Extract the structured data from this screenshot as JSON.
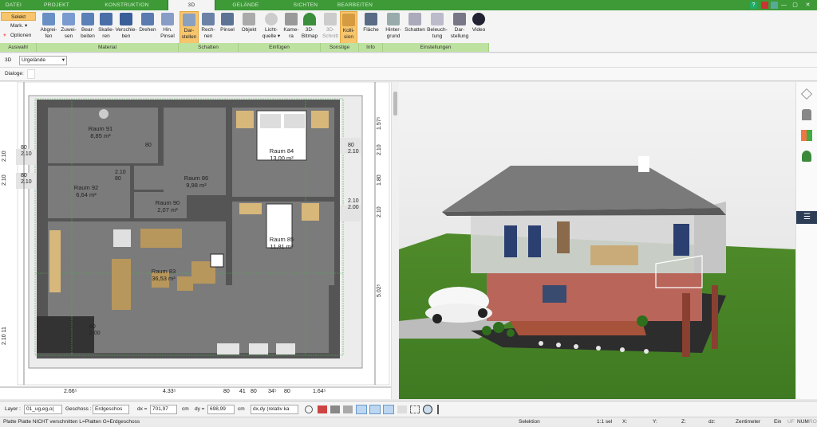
{
  "tabs": [
    {
      "label": "DATEI"
    },
    {
      "label": "PROJEKT"
    },
    {
      "label": "KONSTRUKTION"
    },
    {
      "label": "3D"
    },
    {
      "label": "GELÄNDE"
    },
    {
      "label": "SICHTEN"
    },
    {
      "label": "BEARBEITEN"
    }
  ],
  "selection": {
    "select": "Selekt",
    "mark": "Mark.",
    "options": "Optionen",
    "group": "Auswahl"
  },
  "ribbon": {
    "material": [
      {
        "label": "Abgrei-\nfen"
      },
      {
        "label": "Zuwei-\nsen"
      },
      {
        "label": "Bear-\nbeiten"
      },
      {
        "label": "Skalie-\nren"
      },
      {
        "label": "Verschie-\nben"
      },
      {
        "label": "Drehen"
      },
      {
        "label": "Hin.\nPinsel"
      }
    ],
    "shadow": [
      {
        "label": "Dar-\nstellen"
      },
      {
        "label": "Rech-\nnen"
      },
      {
        "label": "Pinsel"
      }
    ],
    "insert": [
      {
        "label": "Objekt"
      },
      {
        "label": "Licht-\nquelle ▾"
      },
      {
        "label": "Kame-\nra"
      },
      {
        "label": "3D-\nBitmap"
      }
    ],
    "misc": [
      {
        "label": "3D-\nSchnitt"
      },
      {
        "label": "Kolli-\nsion"
      }
    ],
    "info": [
      {
        "label": "Fläche"
      }
    ],
    "settings": [
      {
        "label": "Hinter-\ngrund"
      },
      {
        "label": "Schatten"
      },
      {
        "label": "Beleuch-\ntung"
      },
      {
        "label": "Dar-\nstellung"
      },
      {
        "label": "Video"
      }
    ],
    "groups": {
      "auswahl": "Auswahl",
      "material": "Material",
      "schatten": "Schatten",
      "einfuegen": "Einfügen",
      "sonstige": "Sonstige",
      "info": "Info",
      "einstellungen": "Einstellungen"
    }
  },
  "view": {
    "mode": "3D",
    "terrain": "Urgelände",
    "dialoge": "Dialoge:"
  },
  "rooms": [
    {
      "name": "Raum 91",
      "area": "8,85 m²"
    },
    {
      "name": "Raum 92",
      "area": "6,64 m²"
    },
    {
      "name": "Raum 86",
      "area": "9,98 m²"
    },
    {
      "name": "Raum 90",
      "area": "2,07 m²"
    },
    {
      "name": "Raum 84",
      "area": "13,00 m²"
    },
    {
      "name": "Raum 85",
      "area": "11,81 m²"
    },
    {
      "name": "Raum 83",
      "area": "36,53 m²"
    }
  ],
  "dims": {
    "bottom": [
      "2.66⁵",
      "4.33⁵",
      "80",
      "41",
      "80",
      "34⁵",
      "80",
      "1.64⁵"
    ],
    "right": [
      "1.57⁵",
      "2.10",
      "1.80",
      "2.10",
      "5.02⁵"
    ],
    "left": [
      "2.10",
      "2.10",
      "2.10 11"
    ],
    "small": [
      "80",
      "2.10",
      "80",
      "2.10",
      "80",
      "2.10",
      "80",
      "2.10",
      "80",
      "2.10",
      "2.00",
      "80",
      "2.00",
      "80",
      "2.00",
      "80",
      "2.10",
      "80",
      "2.10",
      "80",
      "2.10",
      "80",
      "2.10",
      "80",
      "2.10"
    ]
  },
  "bottombar": {
    "layer_label": "Layer :",
    "layer_value": "01_ug,eg,o(",
    "floor_label": "Geschoss :",
    "floor_value": "Erdgeschos",
    "dx_label": "dx =",
    "dx_value": "701,97",
    "dy_label": "dy =",
    "dy_value": "698,99",
    "unit": "cm",
    "mode_value": "dx,dy (relativ ka"
  },
  "status": {
    "hint": "Platte Platte NICHT verschnitten L=Platten G=Erdgeschoss",
    "mode": "Selektion",
    "sel": "1:1 sel",
    "x": "X:",
    "y": "Y:",
    "z": "Z:",
    "dz": "dz:",
    "unit": "Zentimeter",
    "ein": "Ein",
    "uf": "UF",
    "num": "NUM",
    "rol": "ROL"
  }
}
